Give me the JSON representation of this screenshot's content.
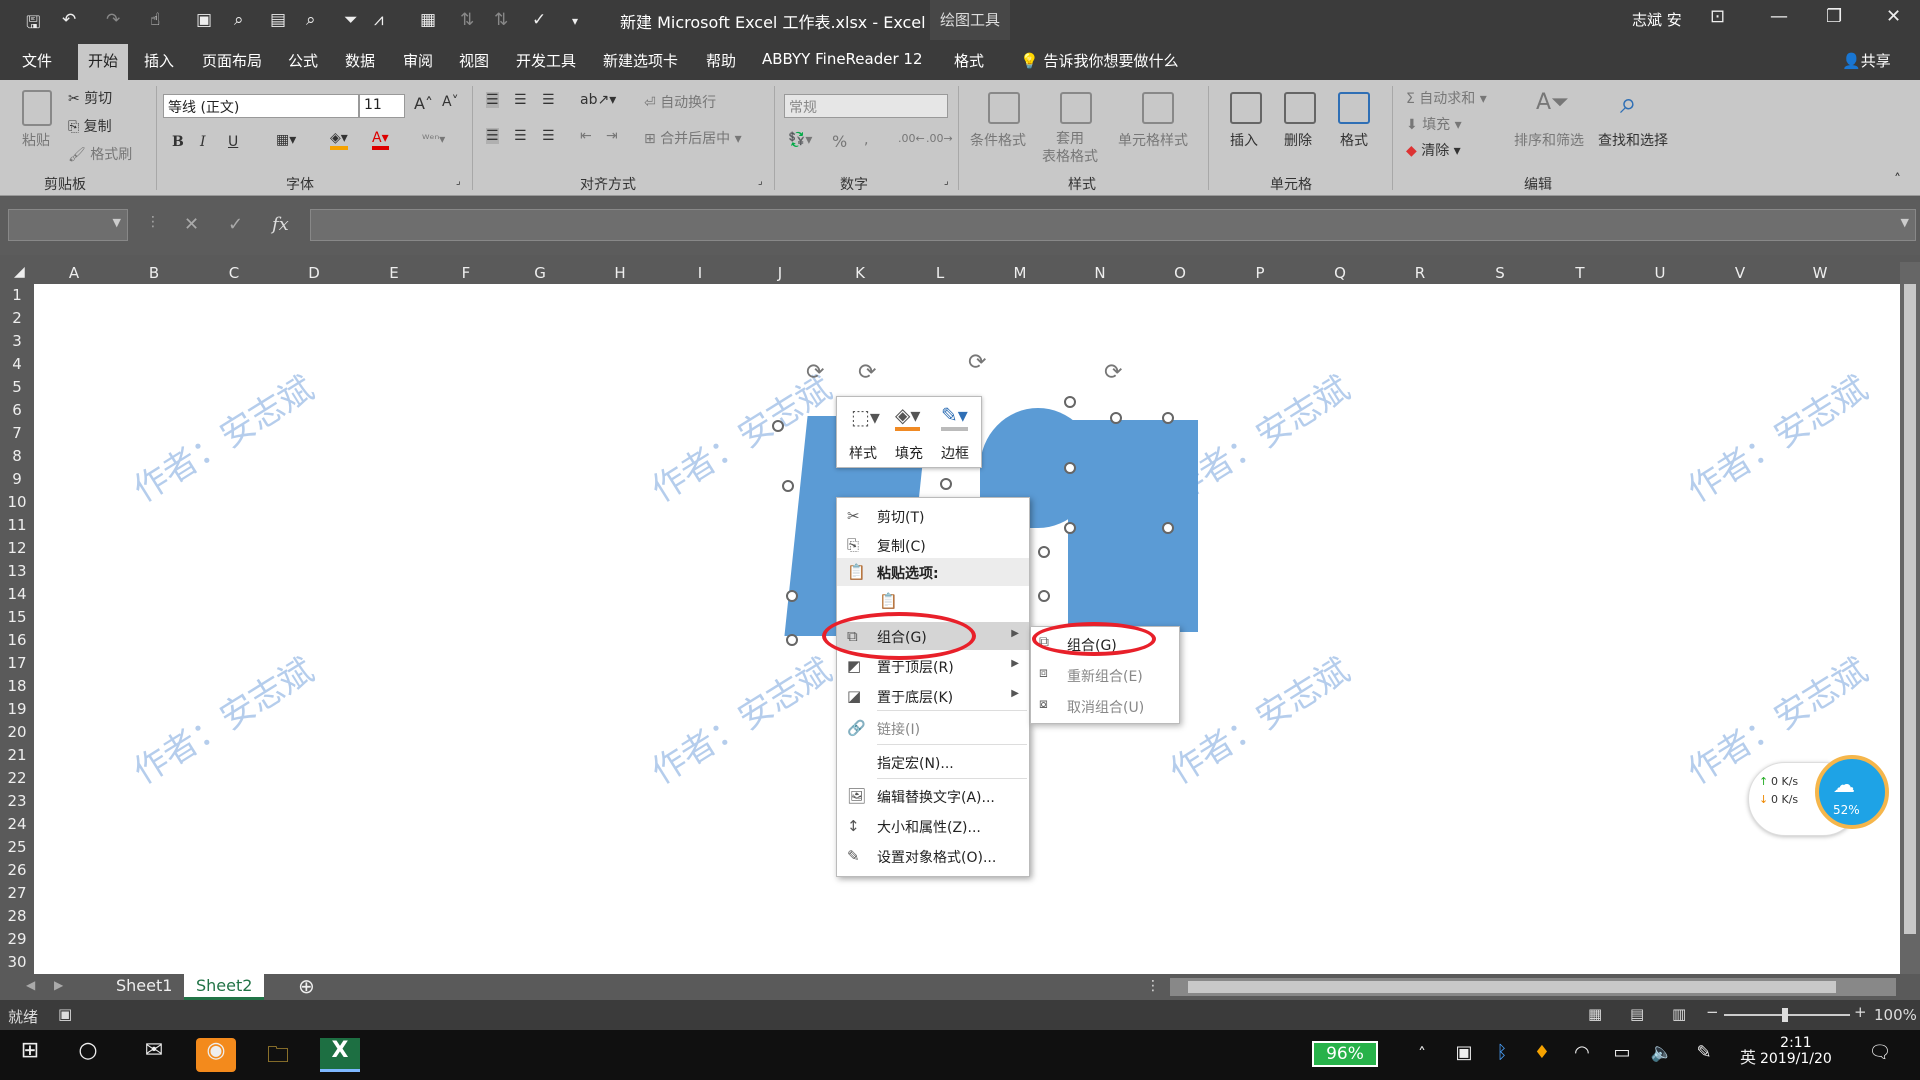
{
  "titlebar": {
    "app_title": "新建 Microsoft Excel 工作表.xlsx  -  Excel",
    "context_tab": "绘图工具",
    "user": "志斌 安"
  },
  "tabs": [
    "文件",
    "开始",
    "插入",
    "页面布局",
    "公式",
    "数据",
    "审阅",
    "视图",
    "开发工具",
    "新建选项卡",
    "帮助",
    "ABBYY FineReader 12",
    "格式"
  ],
  "tellme": "告诉我你想要做什么",
  "share": "共享",
  "ribbon": {
    "clipboard": {
      "label": "剪贴板",
      "paste": "粘贴",
      "cut": "剪切",
      "copy": "复制",
      "painter": "格式刷"
    },
    "font": {
      "label": "字体",
      "name": "等线 (正文)",
      "size": "11",
      "bold": "B",
      "italic": "I",
      "underline": "U"
    },
    "align": {
      "label": "对齐方式",
      "wrap": "自动换行",
      "merge": "合并后居中"
    },
    "number": {
      "label": "数字",
      "format": "常规",
      "percent": "%"
    },
    "styles": {
      "label": "样式",
      "cond": "条件格式",
      "table": "套用\n表格格式",
      "cell": "单元格样式"
    },
    "cells": {
      "label": "单元格",
      "insert": "插入",
      "delete": "删除",
      "format": "格式"
    },
    "edit": {
      "label": "编辑",
      "autosum": "自动求和",
      "fill": "填充",
      "clear": "清除",
      "sort": "排序和筛选",
      "find": "查找和选择"
    }
  },
  "formula": {
    "fx": "fx"
  },
  "columns": [
    "A",
    "B",
    "C",
    "D",
    "E",
    "F",
    "G",
    "H",
    "I",
    "J",
    "K",
    "L",
    "M",
    "N",
    "O",
    "P",
    "Q",
    "R",
    "S",
    "T",
    "U",
    "V",
    "W"
  ],
  "rows": [
    "1",
    "2",
    "3",
    "4",
    "5",
    "6",
    "7",
    "8",
    "9",
    "10",
    "11",
    "12",
    "13",
    "14",
    "15",
    "16",
    "17",
    "18",
    "19",
    "20",
    "21",
    "22",
    "23",
    "24",
    "25",
    "26",
    "27",
    "28",
    "29",
    "30"
  ],
  "watermark": "作者：安志斌",
  "mini_toolbar": {
    "style": "样式",
    "fill": "填充",
    "border": "边框"
  },
  "context_menu": {
    "cut": "剪切(T)",
    "copy": "复制(C)",
    "paste_options": "粘贴选项:",
    "group": "组合(G)",
    "bring_front": "置于顶层(R)",
    "send_back": "置于底层(K)",
    "link": "链接(I)",
    "macro": "指定宏(N)...",
    "alt_text": "编辑替换文字(A)...",
    "size": "大小和属性(Z)...",
    "format_obj": "设置对象格式(O)..."
  },
  "submenu": {
    "group": "组合(G)",
    "regroup": "重新组合(E)",
    "ungroup": "取消组合(U)"
  },
  "sheets": [
    "Sheet1",
    "Sheet2"
  ],
  "status": {
    "ready": "就绪",
    "zoom": "100%"
  },
  "speed": {
    "up": "0  K/s",
    "down": "0  K/s",
    "pct": "52%"
  },
  "taskbar": {
    "battery": "96%",
    "ime": "英",
    "time": "2:11",
    "date": "2019/1/20"
  },
  "colors": {
    "accent": "#217346",
    "shape": "#5b9bd5",
    "ring": "#e8202a"
  }
}
